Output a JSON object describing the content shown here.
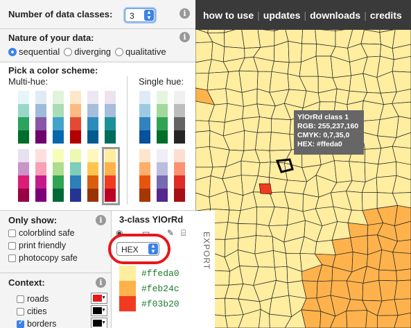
{
  "nav": {
    "items": [
      "how to use",
      "updates",
      "downloads",
      "credits"
    ]
  },
  "classes": {
    "label": "Number of data classes:",
    "value": "3",
    "info": "i"
  },
  "nature": {
    "label": "Nature of your data:",
    "options": [
      "sequential",
      "diverging",
      "qualitative"
    ],
    "selected": "sequential",
    "info": "i"
  },
  "scheme": {
    "label": "Pick a color scheme:",
    "multi_label": "Multi-hue:",
    "single_label": "Single hue:",
    "multi_row1": [
      [
        "#e5f5f9",
        "#99d8c9",
        "#2ca25f",
        "#006d2c"
      ],
      [
        "#e0ecf4",
        "#9ebcda",
        "#8856a7",
        "#6e016b"
      ],
      [
        "#e0f3db",
        "#a8ddb5",
        "#43a2ca",
        "#0868ac"
      ],
      [
        "#fee8c8",
        "#fdbb84",
        "#e34a33",
        "#b30000"
      ],
      [
        "#ece7f2",
        "#a6bddb",
        "#2b8cbe",
        "#045a8d"
      ],
      [
        "#ece2f0",
        "#a6bddb",
        "#1c9099",
        "#016c59"
      ]
    ],
    "multi_row2": [
      [
        "#e7e1ef",
        "#c994c7",
        "#dd1c77",
        "#980043"
      ],
      [
        "#fde0dd",
        "#fa9fb5",
        "#c51b8a",
        "#7a0177"
      ],
      [
        "#f7fcb9",
        "#addd8e",
        "#31a354",
        "#006837"
      ],
      [
        "#edf8b1",
        "#7fcdbb",
        "#2c7fb8",
        "#253494"
      ],
      [
        "#fff7bc",
        "#fec44f",
        "#d95f0e",
        "#993404"
      ],
      [
        "#ffeda0",
        "#feb24c",
        "#f03b20",
        "#bd0026"
      ]
    ],
    "single_row1": [
      [
        "#deebf7",
        "#9ecae1",
        "#3182bd",
        "#08519c"
      ],
      [
        "#e5f5e0",
        "#a1d99b",
        "#31a354",
        "#006d2c"
      ],
      [
        "#f0f0f0",
        "#bdbdbd",
        "#636363",
        "#252525"
      ]
    ],
    "single_row2": [
      [
        "#fee6ce",
        "#fdae6b",
        "#e6550d",
        "#a63603"
      ],
      [
        "#efedf5",
        "#bcbddc",
        "#756bb1",
        "#54278f"
      ],
      [
        "#fee0d2",
        "#fc9272",
        "#de2d26",
        "#a50f15"
      ]
    ]
  },
  "show": {
    "label": "Only show:",
    "info": "i",
    "options": [
      "colorblind safe",
      "print friendly",
      "photocopy safe"
    ]
  },
  "context": {
    "label": "Context:",
    "info": "i",
    "layers": [
      {
        "name": "roads",
        "checked": false,
        "color": "#e8161b"
      },
      {
        "name": "cities",
        "checked": false,
        "color": "#000000"
      },
      {
        "name": "borders",
        "checked": true,
        "color": "#000000"
      }
    ]
  },
  "export": {
    "title": "3-class YlOrRd",
    "tab_label": "EXPORT",
    "format": "HEX",
    "classes": [
      {
        "hex": "#ffeda0",
        "label": "#ffeda0"
      },
      {
        "hex": "#feb24c",
        "label": "#feb24c"
      },
      {
        "hex": "#f03b20",
        "label": "#f03b20"
      }
    ]
  },
  "tooltip": {
    "line1": "YlOrRd class 1",
    "line2": "RGB: 255,237,160",
    "line3": "CMYK: 0,7,35,0",
    "line4": "HEX: #ffeda0"
  },
  "map_colors": {
    "class1": "#ffeda0",
    "class2": "#feb24c",
    "class3": "#f03b20",
    "border": "#222222"
  }
}
